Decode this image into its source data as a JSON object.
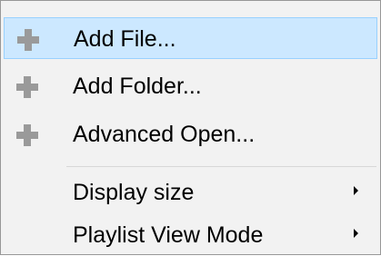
{
  "menu": {
    "items": [
      {
        "label": "Add File...",
        "icon": "plus-icon",
        "highlighted": true
      },
      {
        "label": "Add Folder...",
        "icon": "plus-icon"
      },
      {
        "label": "Advanced Open...",
        "icon": "plus-icon"
      },
      {
        "label": "Display size",
        "submenu": true,
        "icon": "submenu-arrow-icon"
      },
      {
        "label": "Playlist View Mode",
        "submenu": true,
        "icon": "submenu-arrow-icon"
      }
    ]
  },
  "colors": {
    "menu_background": "#f2f2f2",
    "highlight_background": "#cce8ff",
    "highlight_border": "#99d1ff",
    "plus_icon_gray": "#9a9a9a"
  }
}
